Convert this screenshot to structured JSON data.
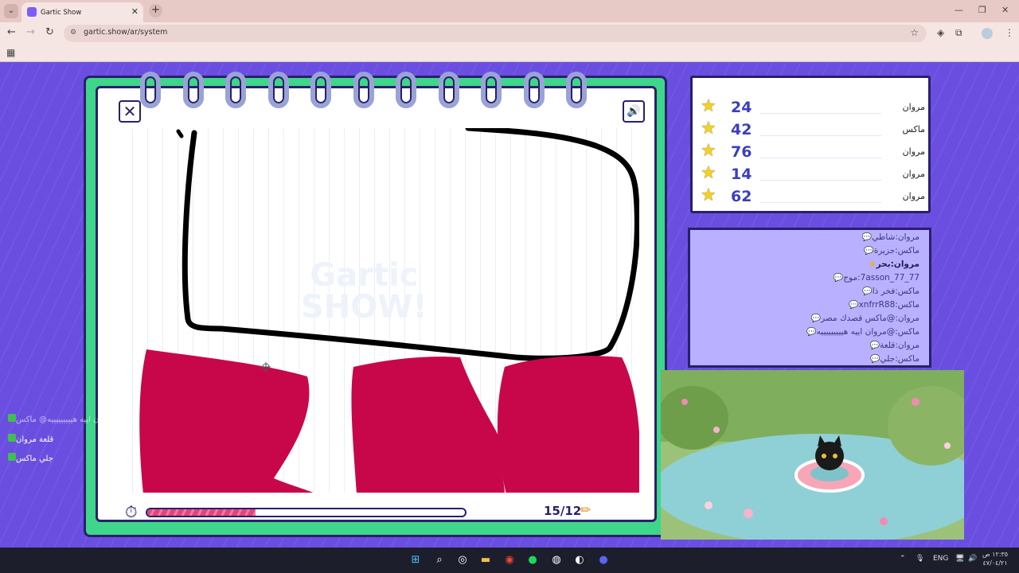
{
  "browser": {
    "tab_title": "Gartic Show",
    "url": "gartic.show/ar/system",
    "new_tab_label": "+",
    "tab_close_label": "✕"
  },
  "game": {
    "close_label": "✕",
    "sound_label": "🔊",
    "watermark_line1": "Gartic",
    "watermark_line2": "SHOW!",
    "round": "15/12",
    "progress_fraction": 0.34
  },
  "scoreboard": [
    {
      "points": "24",
      "name": "مروان"
    },
    {
      "points": "42",
      "name": "ماكس"
    },
    {
      "points": "76",
      "name": "مروان"
    },
    {
      "points": "14",
      "name": "مروان"
    },
    {
      "points": "62",
      "name": "مروان"
    }
  ],
  "chat": [
    {
      "text": "مروان:شاطي",
      "correct": false
    },
    {
      "text": "ماكس:جزيرة",
      "correct": false
    },
    {
      "text": "مروان:بحر",
      "correct": true
    },
    {
      "text": "7asson_77_77:موج",
      "correct": false
    },
    {
      "text": "ماكس:فخر ذا",
      "correct": false
    },
    {
      "text": "ماكس:xnfrrR88",
      "correct": false
    },
    {
      "text": "مروان:@ماكس قصدك مصر",
      "correct": false
    },
    {
      "text": "ماكس:@مروان اييه هيييييييييه",
      "correct": false
    },
    {
      "text": "مروان:قلعة",
      "correct": false
    },
    {
      "text": "ماكس:جلي",
      "correct": false
    }
  ],
  "side_chat": [
    {
      "text": "مروان اييه هيييييييييه@ ماكس"
    },
    {
      "text": "قلعة مروان"
    },
    {
      "text": "جلي ماكس"
    }
  ],
  "taskbar": {
    "lang": "ENG",
    "time": "١٢:٣٥ ص",
    "date": "٤٧/٠٤/٢١"
  },
  "colors": {
    "accent": "#6b4fe0",
    "notebook_frame": "#3ed68a",
    "drawing_red": "#c8074a",
    "score_text": "#3b3fbf"
  }
}
